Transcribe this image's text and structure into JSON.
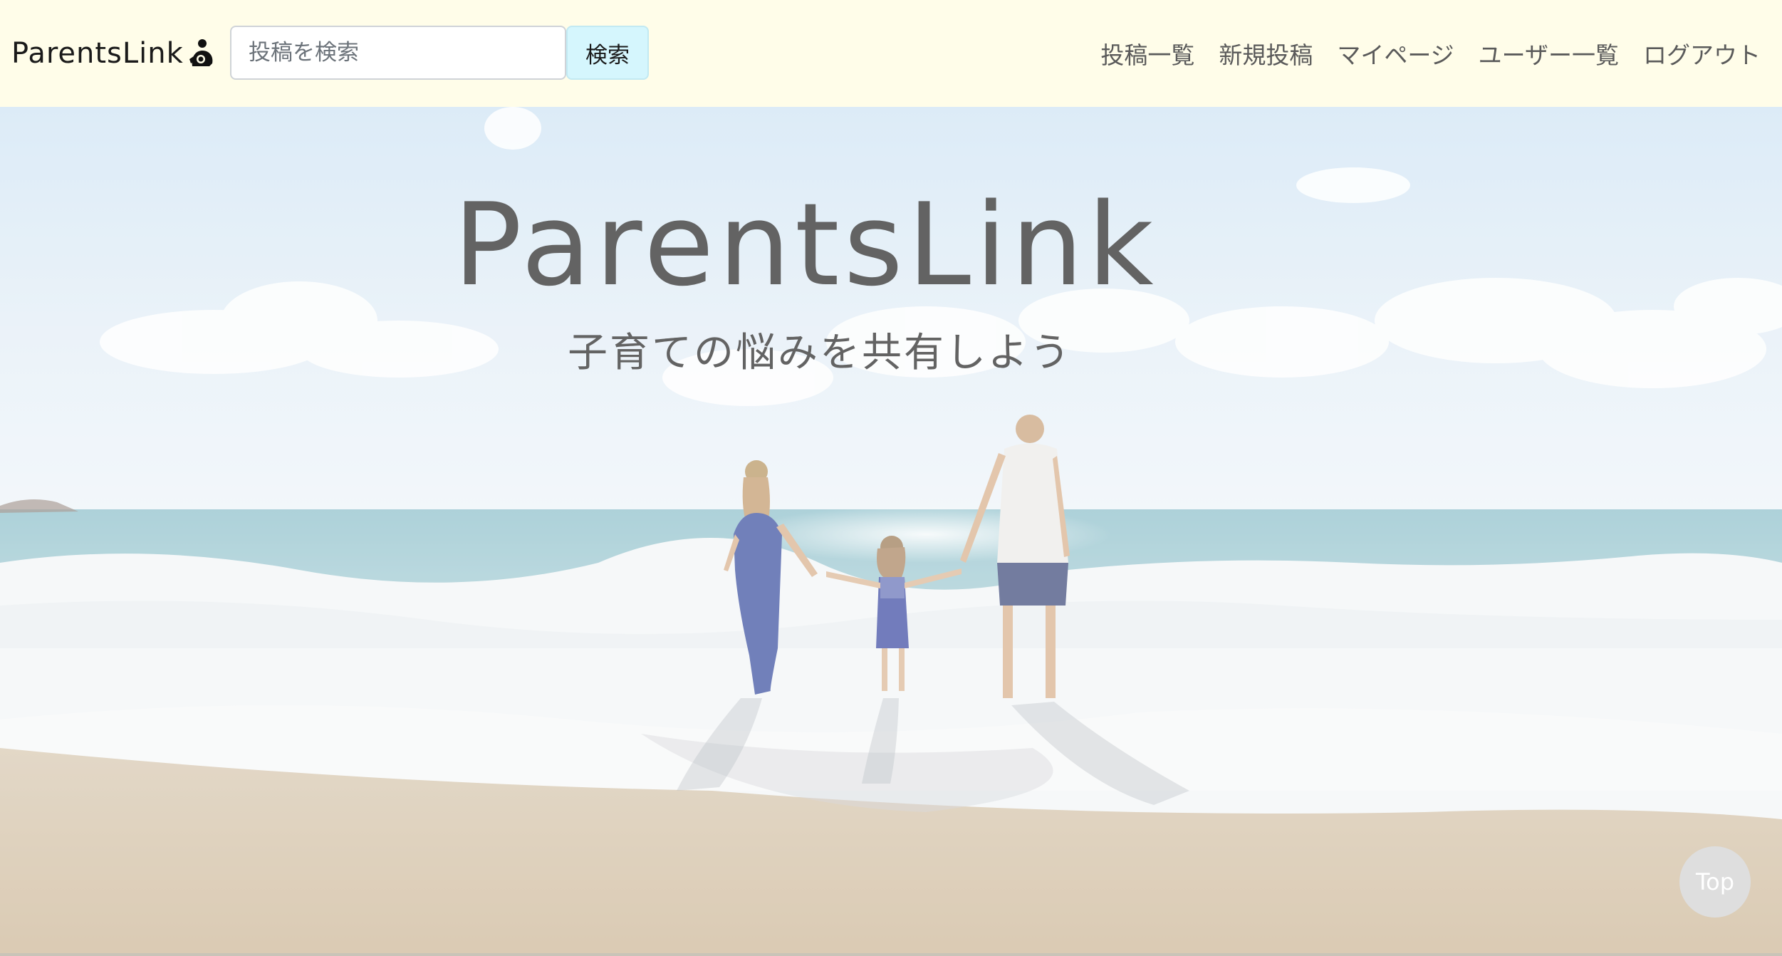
{
  "header": {
    "brand": "ParentsLink",
    "brand_icon": "parent-child-icon",
    "search": {
      "placeholder": "投稿を検索",
      "value": "",
      "button_label": "検索"
    },
    "nav": [
      {
        "label": "投稿一覧"
      },
      {
        "label": "新規投稿"
      },
      {
        "label": "マイページ"
      },
      {
        "label": "ユーザー一覧"
      },
      {
        "label": "ログアウト"
      }
    ]
  },
  "hero": {
    "title": "ParentsLink",
    "subtitle": "子育ての悩みを共有しよう",
    "image": "family-beach-photo"
  },
  "top_button": {
    "label": "Top"
  },
  "colors": {
    "navbar_bg": "#fffde9",
    "search_button_bg": "#d5f6fd",
    "hero_text": "#636363"
  }
}
